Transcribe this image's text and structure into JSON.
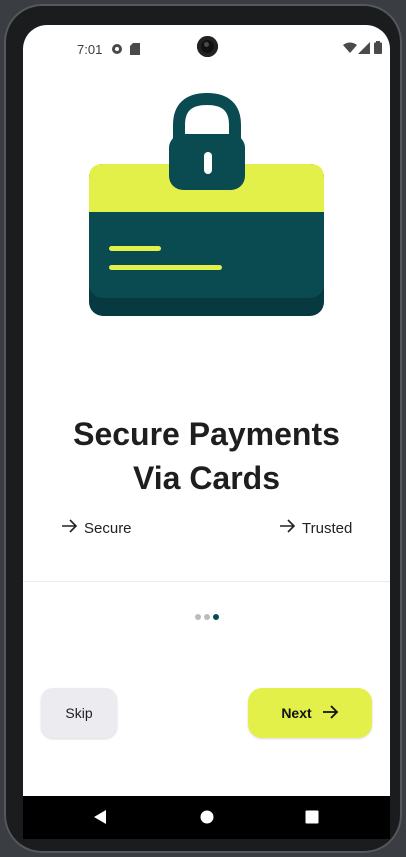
{
  "status_bar": {
    "time": "7:01",
    "left_icons": [
      "screen-record-icon",
      "sd-card-icon"
    ],
    "right_icons": [
      "wifi-icon",
      "signal-icon",
      "battery-icon"
    ]
  },
  "onboarding": {
    "hero_icon": "locked-card-icon",
    "title_line1": "Secure Payments",
    "title_line2": "Via Cards",
    "features": [
      {
        "icon": "arrow-right-icon",
        "label": "Secure"
      },
      {
        "icon": "arrow-right-icon",
        "label": "Trusted"
      }
    ],
    "page_indicator": {
      "total": 3,
      "current": 3
    }
  },
  "actions": {
    "skip_label": "Skip",
    "next_label": "Next"
  },
  "navigation_bar": {
    "buttons": [
      "back-icon",
      "home-icon",
      "recents-icon"
    ]
  },
  "colors": {
    "accent_lime": "#e3f04a",
    "dark_teal": "#0a4b52",
    "darker_teal": "#073a40"
  }
}
